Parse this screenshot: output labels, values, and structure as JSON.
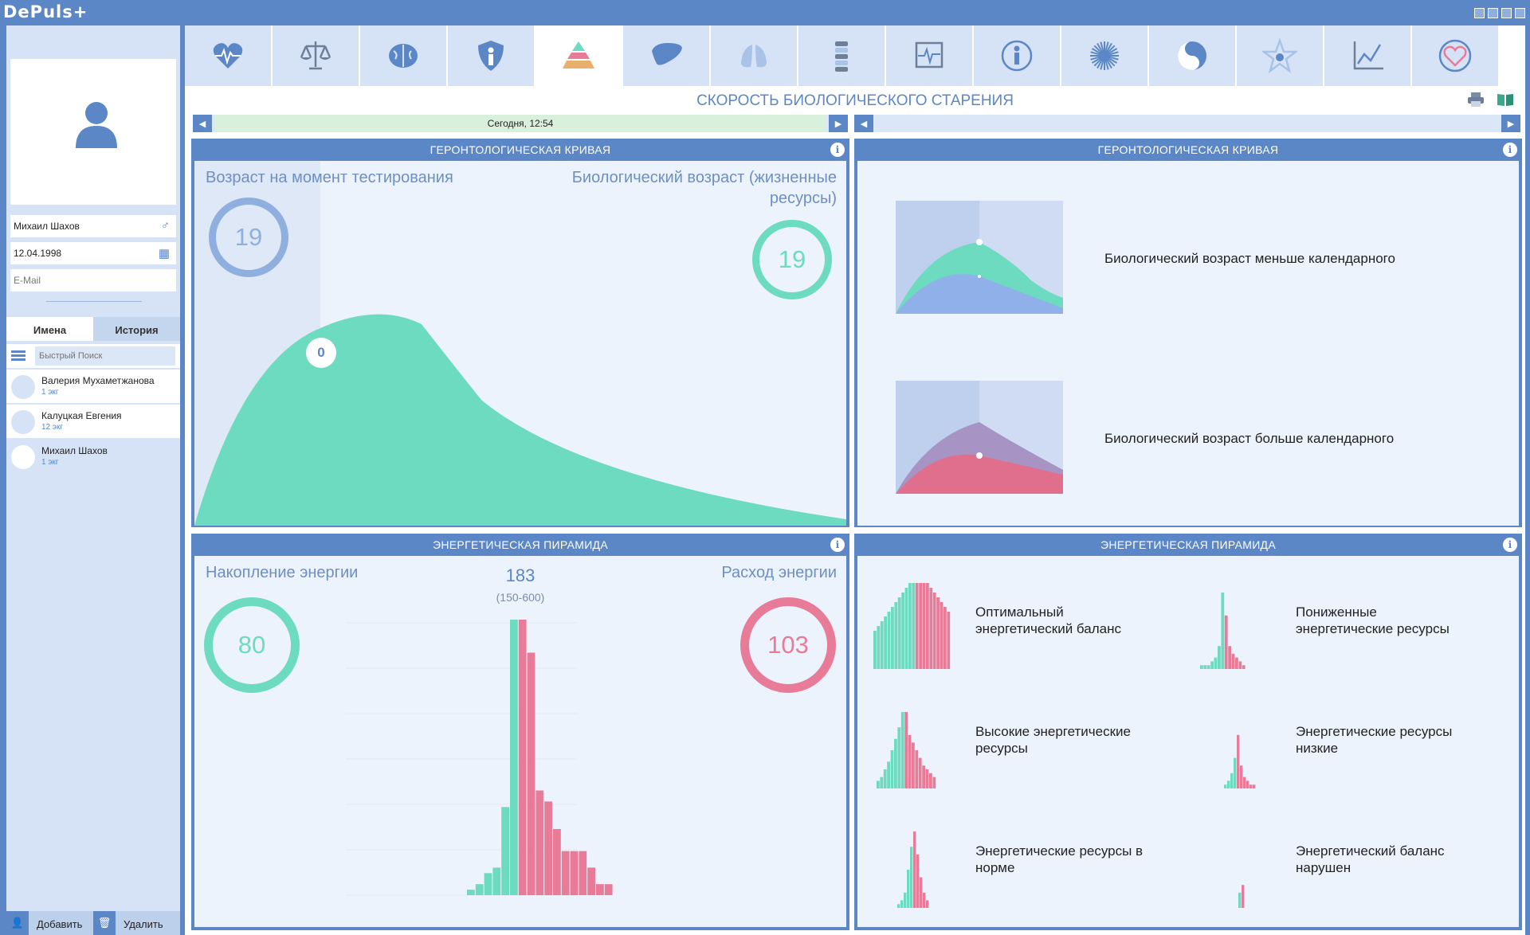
{
  "app": {
    "logo": "DePuls+"
  },
  "patient_card": {
    "name": "Михаил Шахов",
    "birth_date": "12.04.1998",
    "email_placeholder": "E-Mail"
  },
  "list_tabs": {
    "names": "Имена",
    "history": "История"
  },
  "search": {
    "placeholder": "Быстрый Поиск"
  },
  "patients": [
    {
      "name": "Валерия Мухаметжанова",
      "count": "1 экг"
    },
    {
      "name": "Калуцкая Евгения",
      "count": "12 экг"
    },
    {
      "name": "Михаил Шахов",
      "count": "1 экг"
    }
  ],
  "actions": {
    "add": "Добавить",
    "delete": "Удалить"
  },
  "toolbar_icons": [
    "heart-icon",
    "scales-icon",
    "brain-icon",
    "shield-icon",
    "pyramid-icon",
    "liver-icon",
    "lungs-icon",
    "spine-icon",
    "ecg-icon",
    "body-icon",
    "sun-icon",
    "yin-yang-icon",
    "star-icon",
    "chart-icon",
    "heart-circle-icon"
  ],
  "page_title": "СКОРОСТЬ БИОЛОГИЧЕСКОГО СТАРЕНИЯ",
  "nav": {
    "date": "Сегодня, 12:54"
  },
  "gero": {
    "title": "ГЕРОНТОЛОГИЧЕСКАЯ КРИВАЯ",
    "age_label": "Возраст на момент тестирования",
    "bio_label_1": "Биологический возраст (жизненные",
    "bio_label_2": "ресурсы)",
    "age_value": "19",
    "bio_value": "19",
    "marker_value": "0"
  },
  "gero_legend": {
    "title": "ГЕРОНТОЛОГИЧЕСКАЯ КРИВАЯ",
    "less": "Биологический возраст меньше календарного",
    "more": "Биологический возраст больше календарного"
  },
  "energy": {
    "title": "ЭНЕРГЕТИЧЕСКАЯ ПИРАМИДА",
    "accumulation_label": "Накопление энергии",
    "expense_label": "Расход энергии",
    "total": "183",
    "range": "(150-600)",
    "accumulation_value": "80",
    "expense_value": "103"
  },
  "energy_legend": {
    "title": "ЭНЕРГЕТИЧЕСКАЯ ПИРАМИДА",
    "optimal_1": "Оптимальный",
    "optimal_2": "энергетический баланс",
    "reduced_1": "Пониженные",
    "reduced_2": "энергетические ресурсы",
    "high_1": "Высокие энергетические",
    "high_2": "ресурсы",
    "low_1": "Энергетические ресурсы",
    "low_2": "низкие",
    "normal_1": "Энергетические ресурсы в",
    "normal_2": "норме",
    "broken_1": "Энергетический баланс",
    "broken_2": "нарушен"
  },
  "colors": {
    "accent": "#5b87c7",
    "green": "#6ddbbf",
    "pink": "#e87c98",
    "panel_bg": "#edf3fc"
  },
  "chart_data": {
    "type": "bar",
    "title": "",
    "series": [
      {
        "values": [
          1,
          2,
          4,
          5,
          16,
          50
        ]
      },
      {
        "values": [
          50,
          44,
          19,
          17,
          12,
          8,
          8,
          8,
          5,
          2,
          2
        ]
      }
    ]
  }
}
